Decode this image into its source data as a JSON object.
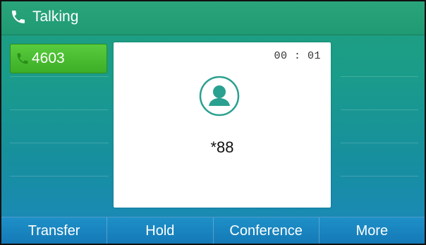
{
  "header": {
    "title": "Talking",
    "icon": "phone-icon"
  },
  "line_keys": [
    {
      "label": "4603",
      "icon": "phone-icon",
      "active": true,
      "color": "#4fbd35"
    }
  ],
  "call": {
    "timer": "00 : 01",
    "callee": "*88",
    "avatar_icon": "person-icon"
  },
  "softkeys": [
    "Transfer",
    "Hold",
    "Conference",
    "More"
  ],
  "colors": {
    "accent_teal": "#1a9c8a",
    "softkey_blue": "#1479b6",
    "line_green": "#4fbd35",
    "avatar_ring": "#2aa090"
  }
}
